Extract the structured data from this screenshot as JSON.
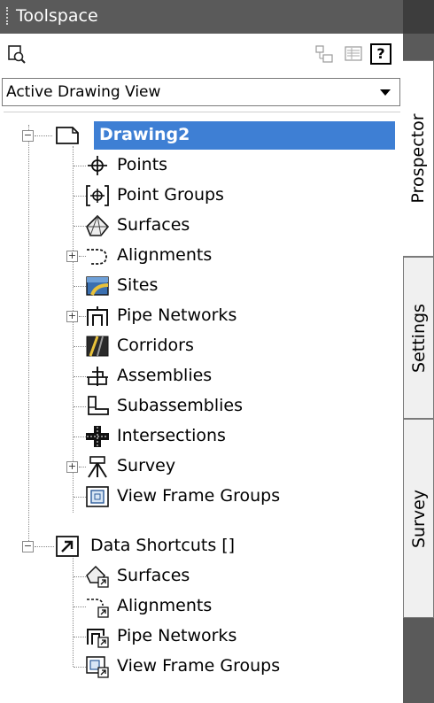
{
  "window": {
    "title": "Toolspace"
  },
  "toolbar": {
    "help_label": "?"
  },
  "view_selector": {
    "value": "Active Drawing View"
  },
  "tabs": [
    {
      "label": "Prospector"
    },
    {
      "label": "Settings"
    },
    {
      "label": "Survey"
    }
  ],
  "tree": {
    "drawing": {
      "label": "Drawing2",
      "children": [
        {
          "label": "Points"
        },
        {
          "label": "Point Groups"
        },
        {
          "label": "Surfaces"
        },
        {
          "label": "Alignments"
        },
        {
          "label": "Sites"
        },
        {
          "label": "Pipe Networks"
        },
        {
          "label": "Corridors"
        },
        {
          "label": "Assemblies"
        },
        {
          "label": "Subassemblies"
        },
        {
          "label": "Intersections"
        },
        {
          "label": "Survey"
        },
        {
          "label": "View Frame Groups"
        }
      ]
    },
    "shortcuts": {
      "label": "Data Shortcuts []",
      "children": [
        {
          "label": "Surfaces"
        },
        {
          "label": "Alignments"
        },
        {
          "label": "Pipe Networks"
        },
        {
          "label": "View Frame Groups"
        }
      ]
    }
  },
  "expander_symbols": {
    "collapse": "−",
    "expand": "+"
  },
  "colors": {
    "selection": "#3e7fd4",
    "titlebar": "#5a5a5a"
  }
}
